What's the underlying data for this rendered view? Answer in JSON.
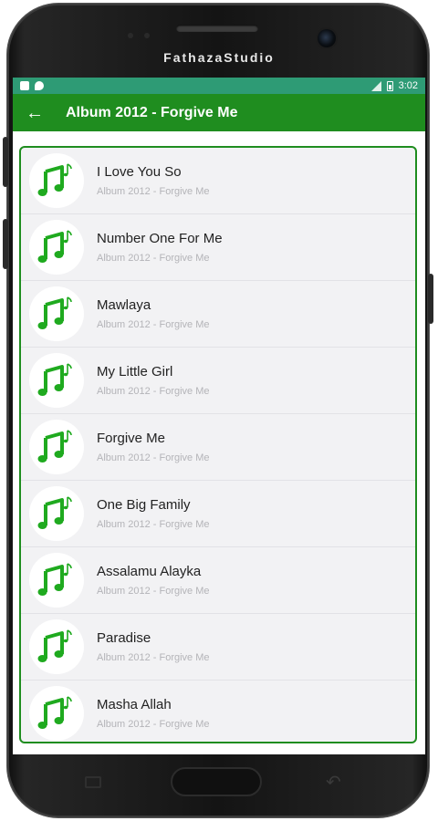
{
  "device": {
    "brand_text": "FathazaStudio"
  },
  "status_bar": {
    "time": "3:02"
  },
  "app_bar": {
    "back_icon": "arrow-left-icon",
    "title": "Album 2012 - Forgive Me"
  },
  "songs": [
    {
      "title": "I Love You So",
      "subtitle": "Album 2012 - Forgive Me"
    },
    {
      "title": "Number One For Me",
      "subtitle": "Album 2012 - Forgive Me"
    },
    {
      "title": "Mawlaya",
      "subtitle": "Album 2012 - Forgive Me"
    },
    {
      "title": "My Little Girl",
      "subtitle": "Album 2012 - Forgive Me"
    },
    {
      "title": "Forgive Me",
      "subtitle": "Album 2012 - Forgive Me"
    },
    {
      "title": "One Big Family",
      "subtitle": "Album 2012 - Forgive Me"
    },
    {
      "title": "Assalamu Alayka",
      "subtitle": "Album 2012 - Forgive Me"
    },
    {
      "title": "Paradise",
      "subtitle": "Album 2012 - Forgive Me"
    },
    {
      "title": "Masha Allah",
      "subtitle": "Album 2012 - Forgive Me"
    }
  ],
  "song_icon": "music-note-icon",
  "colors": {
    "status_bar": "#2e9b75",
    "app_bar": "#1f8d1f",
    "note_green": "#1faa1f",
    "list_background": "#f2f2f4"
  }
}
